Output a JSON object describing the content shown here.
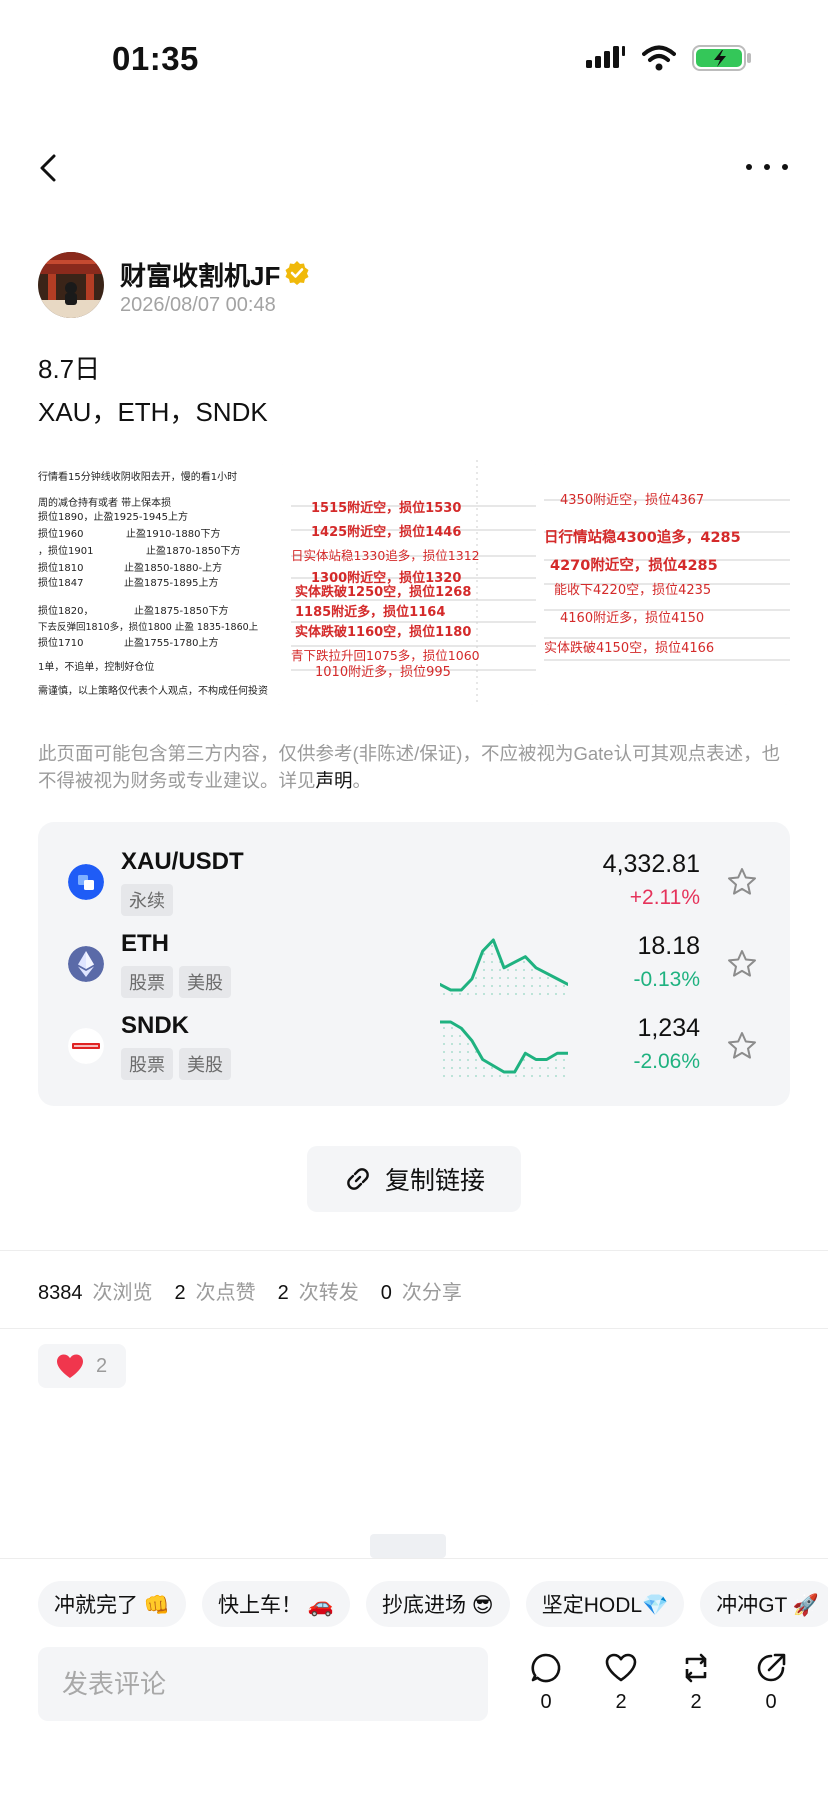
{
  "status_bar": {
    "time": "01:35"
  },
  "author": {
    "name": "财富收割机JF",
    "time": "2026/08/07 00:48"
  },
  "post": {
    "line1": "8.7日",
    "line2": "XAU，ETH，SNDK"
  },
  "images": {
    "img1": [
      "行情看15分钟线收阴收阳去开，慢的看1小时",
      "周的减仓持有或者 带上保本损",
      "损位1890，止盈1925-1945上方",
      "损位1960",
      "止盈1910-1880下方",
      "，损位1901",
      "止盈1870-1850下方",
      "损位1810",
      "止盈1850-1880-上方",
      "损位1847",
      "止盈1875-1895上方",
      "损位1820，",
      "止盈1875-1850下方",
      "下去反弹回1810多，损位1800 止盈 1835-1860上",
      "损位1710",
      "止盈1755-1780上方",
      "1单，不追单，控制好仓位",
      "需谨慎，以上策略仅代表个人观点，不构成任何投资"
    ],
    "img2": [
      "1515附近空，损位1530",
      "1425附近空，损位1446",
      "日实体站稳1330追多，损位1312",
      "1300附近空，损位1320",
      "实体跌破1250空，损位1268",
      "1185附近多，损位1164",
      "实体跌破1160空，损位1180",
      "青下跌拉升回1075多，损位1060",
      "1010附近多，损位995"
    ],
    "img3": [
      "4350附近空，损位4367",
      "日行情站稳4300追多，4285",
      "4270附近空，损位4285",
      "能收下4220空，损位4235",
      "4160附近多，损位4150",
      "实体跌破4150空，损位4166"
    ]
  },
  "disclaimer": {
    "text": "此页面可能包含第三方内容，仅供参考(非陈述/保证)，不应被视为Gate认可其观点表述，也不得被视为财务或专业建议。详见",
    "link": "声明",
    "end": "。"
  },
  "markets": [
    {
      "symbol": "XAU/USDT",
      "tags": [
        "永续"
      ],
      "price": "4,332.81",
      "change": "+2.11%",
      "change_color": "#e5335b",
      "icon": "xau-token-icon",
      "sparkline": []
    },
    {
      "symbol": "ETH",
      "tags": [
        "股票",
        "美股"
      ],
      "price": "18.18",
      "change": "-0.13%",
      "change_color": "#1fb280",
      "icon": "eth-icon",
      "sparkline": [
        3,
        2,
        2,
        4,
        9,
        11,
        6,
        7,
        8,
        6,
        5,
        4,
        3
      ]
    },
    {
      "symbol": "SNDK",
      "tags": [
        "股票",
        "美股"
      ],
      "price": "1,234",
      "change": "-2.06%",
      "change_color": "#1fb280",
      "icon": "sndk-logo-icon",
      "sparkline": [
        9,
        9,
        8,
        6,
        3,
        2,
        1,
        1,
        4,
        3,
        3,
        4,
        4
      ]
    }
  ],
  "copy_link": {
    "label": "复制链接"
  },
  "stats": {
    "views": "8384",
    "views_label": "次浏览",
    "likes": "2",
    "likes_label": "次点赞",
    "reposts": "2",
    "reposts_label": "次转发",
    "shares": "0",
    "shares_label": "次分享"
  },
  "reaction": {
    "count": "2"
  },
  "chips": [
    "冲就完了 👊",
    "快上车！ 🚗",
    "抄底进场 😎",
    "坚定HODL💎",
    "冲冲GT 🚀"
  ],
  "comment": {
    "placeholder": "发表评论"
  },
  "actions": {
    "comments": "0",
    "likes": "2",
    "reposts": "2",
    "shares": "0"
  },
  "colors": {
    "accent_green": "#1fb280",
    "accent_red": "#e5335b",
    "verified_gold": "#f0b90b"
  }
}
